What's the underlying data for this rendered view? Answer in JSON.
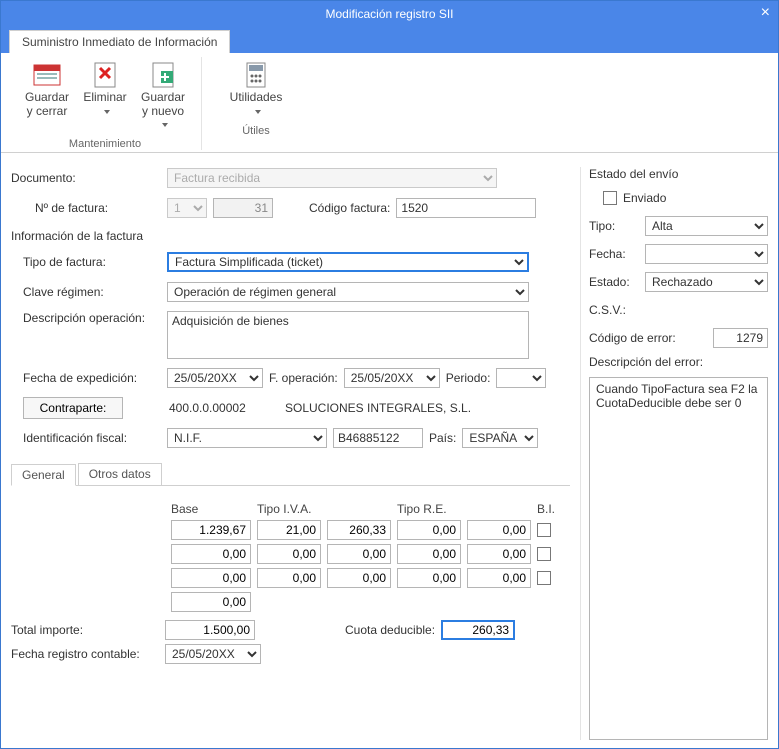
{
  "title": "Modificación registro SII",
  "outerTab": "Suministro Inmediato de Información",
  "ribbon": {
    "group1_label": "Mantenimiento",
    "group2_label": "Útiles",
    "save_close": "Guardar y cerrar",
    "delete": "Eliminar",
    "save_new": "Guardar y nuevo",
    "utilities": "Utilidades"
  },
  "left": {
    "documento_lbl": "Documento:",
    "documento_val": "Factura recibida",
    "n_factura_lbl": "Nº de factura:",
    "n_factura_a": "1",
    "n_factura_b": "31",
    "codigo_factura_lbl": "Código factura:",
    "codigo_factura_val": "1520",
    "info_factura_title": "Información de la factura",
    "tipo_factura_lbl": "Tipo de factura:",
    "tipo_factura_val": "Factura Simplificada (ticket)",
    "clave_regimen_lbl": "Clave régimen:",
    "clave_regimen_val": "Operación de régimen general",
    "desc_oper_lbl": "Descripción operación:",
    "desc_oper_val": "Adquisición de bienes",
    "fecha_exp_lbl": "Fecha de expedición:",
    "fecha_exp_val": "25/05/20XX",
    "f_operacion_lbl": "F. operación:",
    "f_operacion_val": "25/05/20XX",
    "periodo_lbl": "Periodo:",
    "periodo_val": "",
    "contraparte_btn": "Contraparte:",
    "contraparte_code": "400.0.0.00002",
    "contraparte_name": "SOLUCIONES INTEGRALES, S.L.",
    "ident_fiscal_lbl": "Identificación fiscal:",
    "ident_fiscal_type": "N.I.F.",
    "ident_fiscal_val": "B46885122",
    "pais_lbl": "País:",
    "pais_val": "ESPAÑA",
    "tab_general": "General",
    "tab_otros": "Otros datos",
    "col_base": "Base",
    "col_tipo_iva": "Tipo I.V.A.",
    "col_tipo_re": "Tipo R.E.",
    "col_bi": "B.I.",
    "rows": [
      {
        "base": "1.239,67",
        "iva_t": "21,00",
        "iva_c": "260,33",
        "re_t": "0,00",
        "re_c": "0,00"
      },
      {
        "base": "0,00",
        "iva_t": "0,00",
        "iva_c": "0,00",
        "re_t": "0,00",
        "re_c": "0,00"
      },
      {
        "base": "0,00",
        "iva_t": "0,00",
        "iva_c": "0,00",
        "re_t": "0,00",
        "re_c": "0,00"
      }
    ],
    "extra_base": "0,00",
    "total_importe_lbl": "Total importe:",
    "total_importe_val": "1.500,00",
    "cuota_deducible_lbl": "Cuota deducible:",
    "cuota_deducible_val": "260,33",
    "fecha_reg_lbl": "Fecha registro contable:",
    "fecha_reg_val": "25/05/20XX"
  },
  "right": {
    "title": "Estado del envío",
    "enviado_lbl": "Enviado",
    "tipo_lbl": "Tipo:",
    "tipo_val": "Alta",
    "fecha_lbl": "Fecha:",
    "fecha_val": "",
    "estado_lbl": "Estado:",
    "estado_val": "Rechazado",
    "csv_lbl": "C.S.V.:",
    "codigo_err_lbl": "Código de error:",
    "codigo_err_val": "1279",
    "desc_err_lbl": "Descripción del error:",
    "desc_err_val": "Cuando TipoFactura sea F2 la CuotaDeducible debe ser 0"
  }
}
